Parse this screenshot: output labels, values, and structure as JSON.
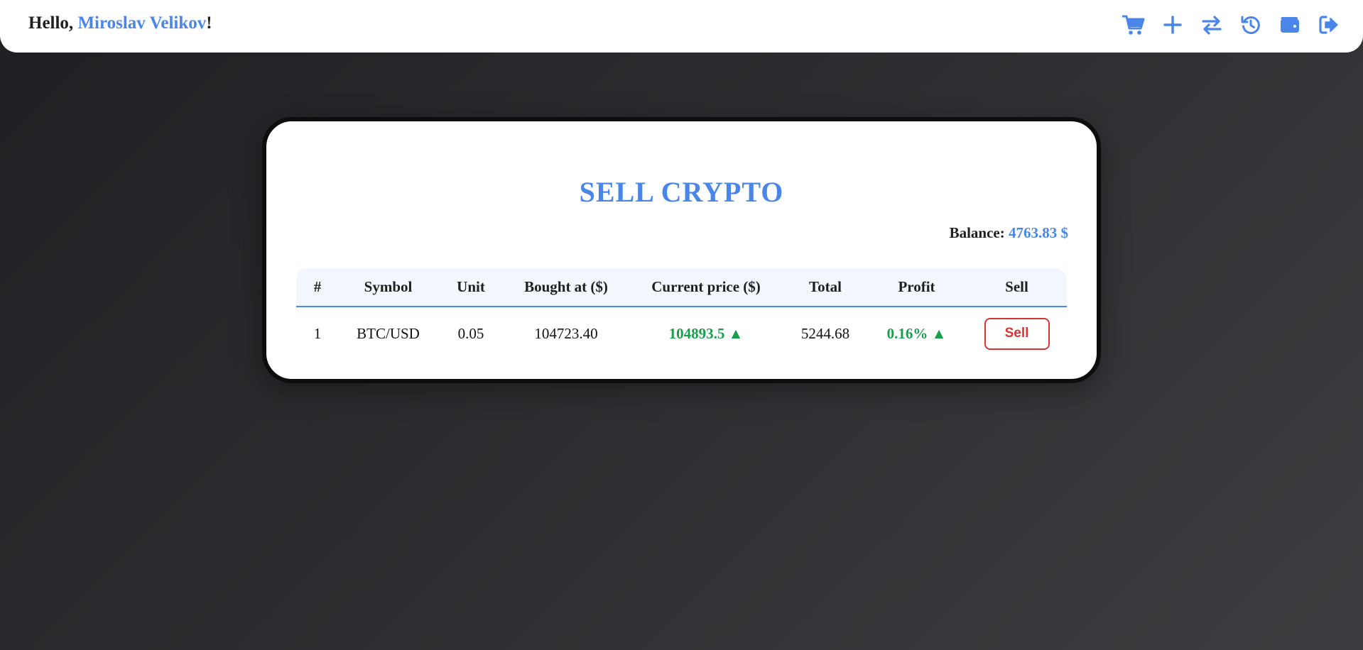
{
  "header": {
    "greeting_prefix": "Hello, ",
    "user_name": "Miroslav Velikov",
    "greeting_suffix": "!",
    "nav_icons": [
      "cart-icon",
      "plus-icon",
      "exchange-icon",
      "history-icon",
      "wallet-icon",
      "logout-icon"
    ]
  },
  "page": {
    "title": "SELL CRYPTO",
    "balance_label": "Balance: ",
    "balance_value": "4763.83 $"
  },
  "table": {
    "columns": [
      "#",
      "Symbol",
      "Unit",
      "Bought at ($)",
      "Current price ($)",
      "Total",
      "Profit",
      "Sell"
    ],
    "rows": [
      {
        "index": "1",
        "symbol": "BTC/USD",
        "unit": "0.05",
        "bought_at": "104723.40",
        "current_price": "104893.5 ▲",
        "total": "5244.68",
        "profit": "0.16% ▲",
        "sell_label": "Sell"
      }
    ]
  },
  "colors": {
    "accent": "#4a86e8",
    "positive": "#1a9e4b",
    "danger": "#d93434"
  }
}
